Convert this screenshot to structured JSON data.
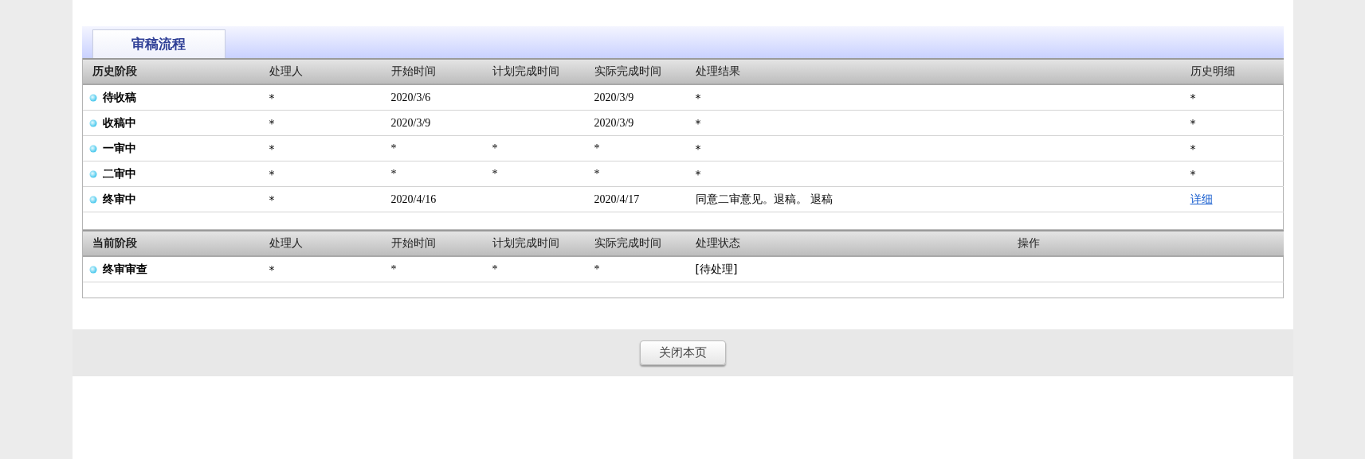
{
  "tabs": [
    {
      "label": "审稿流程",
      "selected": true
    }
  ],
  "history": {
    "columns": [
      "历史阶段",
      "处理人",
      "开始时间",
      "计划完成时间",
      "实际完成时间",
      "处理结果",
      "历史明细"
    ],
    "rows": [
      {
        "stage": "待收稿",
        "handler": "*",
        "start": "2020/3/6",
        "actual": "2020/3/9",
        "result": "*",
        "detail": {
          "kind": "text",
          "text": "*"
        }
      },
      {
        "stage": "收稿中",
        "handler": "*",
        "start": "2020/3/9",
        "actual": "2020/3/9",
        "result": "*",
        "detail": {
          "kind": "text",
          "text": "*"
        }
      },
      {
        "stage": "一审中",
        "handler": "*",
        "start": "*",
        "planned": "*",
        "actual": "*",
        "result": "*",
        "detail": {
          "kind": "text",
          "text": "*"
        }
      },
      {
        "stage": "二审中",
        "handler": "*",
        "start": "*",
        "planned": "*",
        "actual": "*",
        "result": "*",
        "detail": {
          "kind": "text",
          "text": "*"
        }
      },
      {
        "stage": "终审中",
        "handler": "*",
        "start": "2020/4/16",
        "actual": "2020/4/17",
        "result": "同意二审意见。退稿。 退稿",
        "detail": {
          "kind": "link",
          "text": "详细"
        }
      }
    ]
  },
  "current": {
    "columns": [
      "当前阶段",
      "处理人",
      "开始时间",
      "计划完成时间",
      "实际完成时间",
      "处理状态",
      "操作"
    ],
    "rows": [
      {
        "stage": "终审审查",
        "handler": "*",
        "start": "*",
        "planned": "*",
        "actual": "*",
        "status": "[待处理]"
      }
    ]
  },
  "close_button": "关闭本页"
}
